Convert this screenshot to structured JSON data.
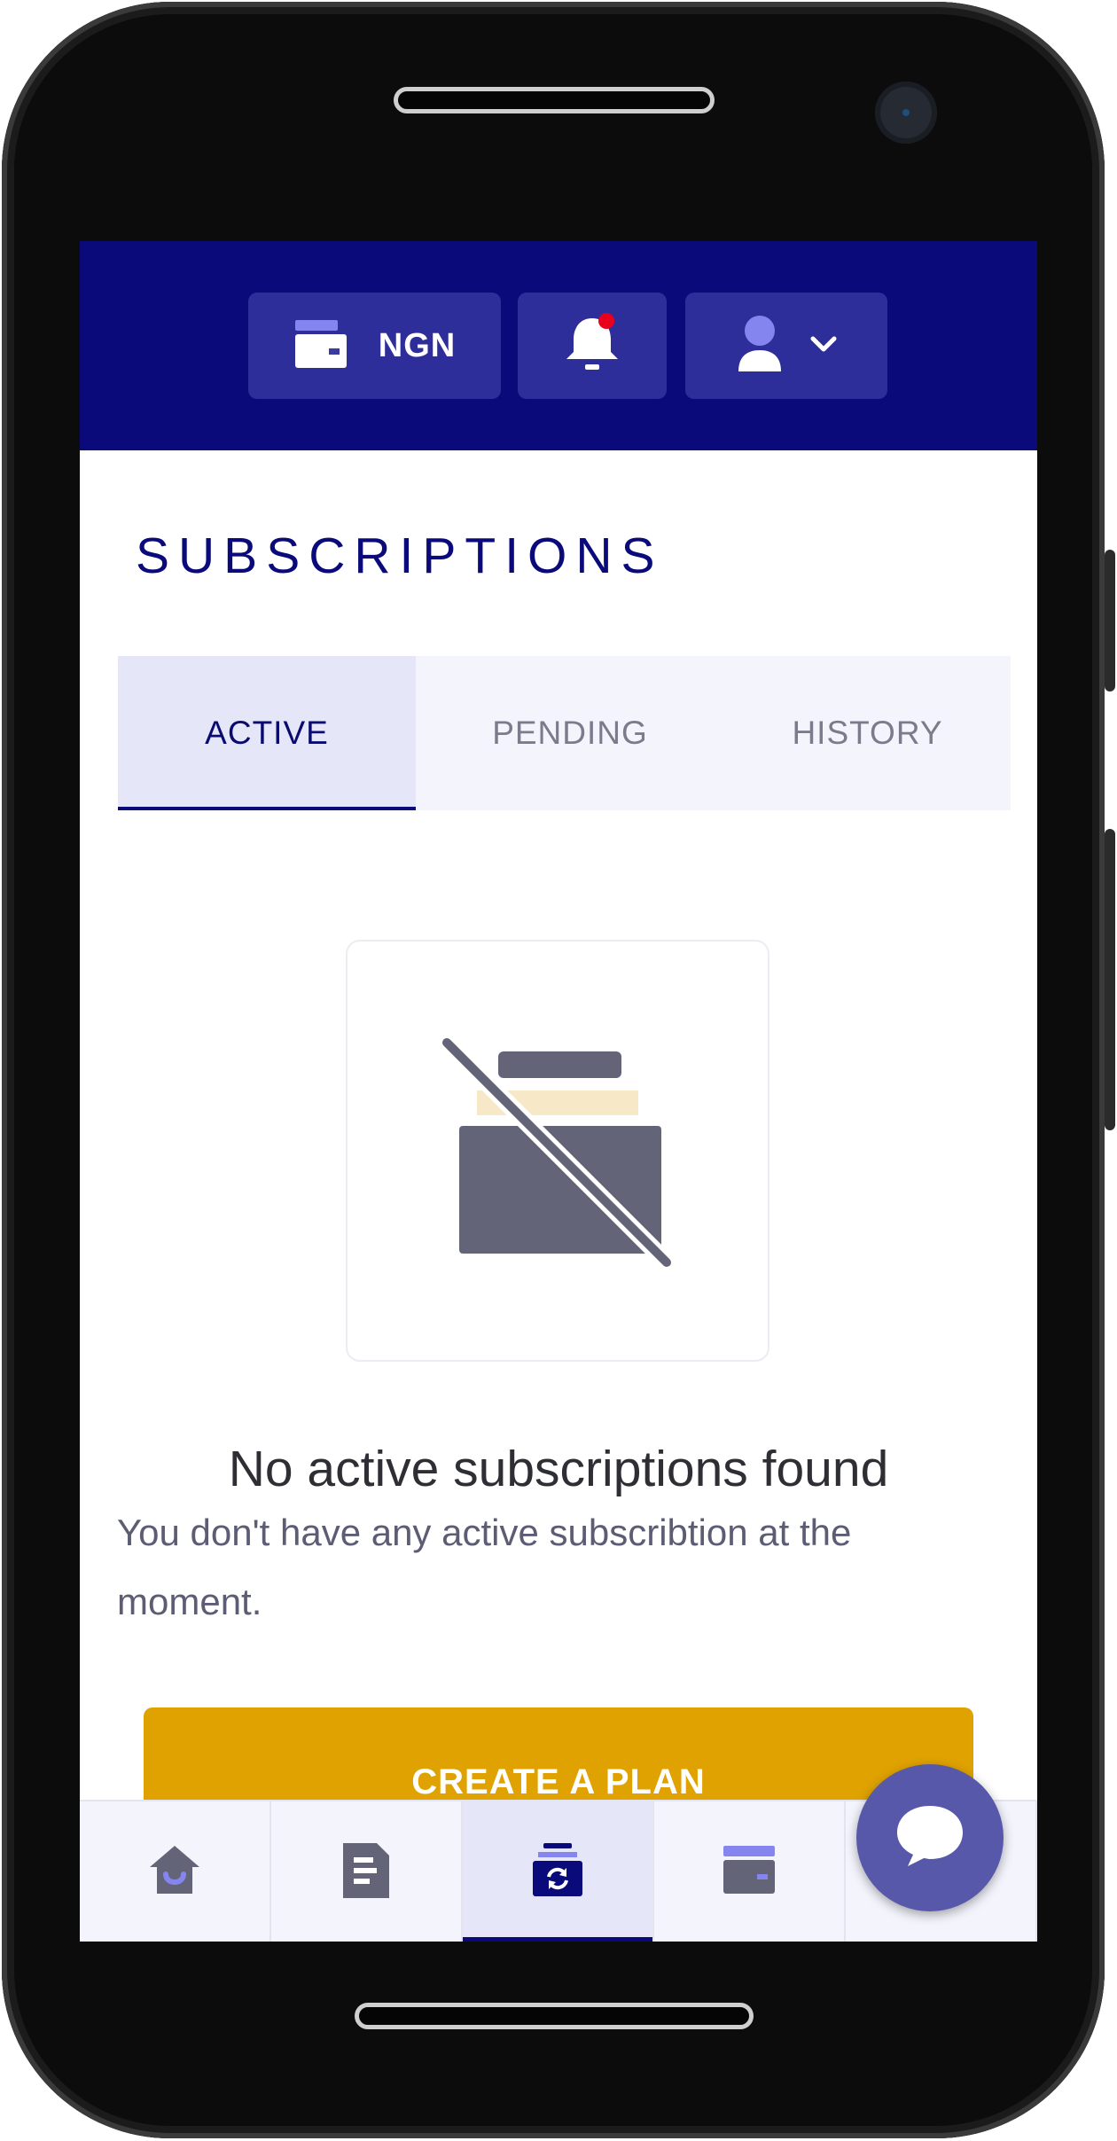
{
  "header": {
    "currency_label": "NGN",
    "wallet_icon": "wallet-icon",
    "bell_icon": "bell-icon",
    "user_icon": "user-icon",
    "chevron_icon": "chevron-down-icon",
    "brand_color": "#0a0a7a",
    "notification_dot_color": "#e8001c"
  },
  "page": {
    "title": "SUBSCRIPTIONS"
  },
  "tabs": [
    {
      "label": "ACTIVE",
      "active": true
    },
    {
      "label": "PENDING",
      "active": false
    },
    {
      "label": "HISTORY",
      "active": false
    }
  ],
  "empty_state": {
    "icon": "no-subscriptions-icon",
    "title": "No active subscriptions found",
    "description": "You don't have any active subscribtion at the moment."
  },
  "cta": {
    "label": "CREATE A PLAN",
    "color": "#dfa200"
  },
  "bottom_nav": [
    {
      "icon": "home-icon",
      "active": false
    },
    {
      "icon": "document-icon",
      "active": false
    },
    {
      "icon": "subscriptions-icon",
      "active": true
    },
    {
      "icon": "wallet-icon",
      "active": false
    },
    {
      "icon": "more-icon",
      "active": false
    }
  ],
  "chat": {
    "icon": "chat-bubble-icon"
  }
}
